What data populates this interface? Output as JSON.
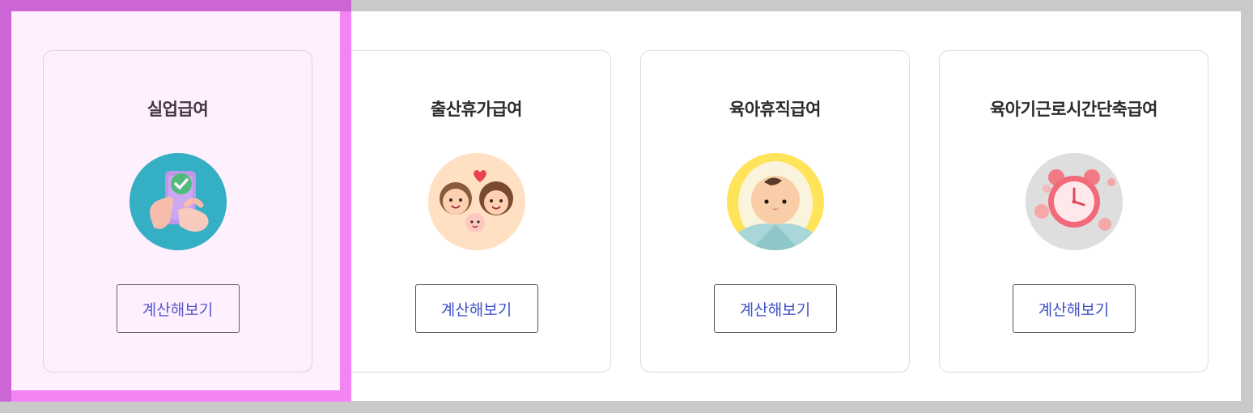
{
  "cards": [
    {
      "title": "실업급여",
      "button_label": "계산해보기",
      "icon": "phone-check-icon",
      "icon_bg": "#1ab5bd"
    },
    {
      "title": "출산휴가급여",
      "button_label": "계산해보기",
      "icon": "family-icon",
      "icon_bg": "#ffe0c2"
    },
    {
      "title": "육아휴직급여",
      "button_label": "계산해보기",
      "icon": "baby-icon",
      "icon_bg": "#ffe45a"
    },
    {
      "title": "육아기근로시간단축급여",
      "button_label": "계산해보기",
      "icon": "alarm-clock-icon",
      "icon_bg": "#dedede"
    }
  ],
  "colors": {
    "button_text": "#3f51c8",
    "highlight": "#f483f4"
  }
}
